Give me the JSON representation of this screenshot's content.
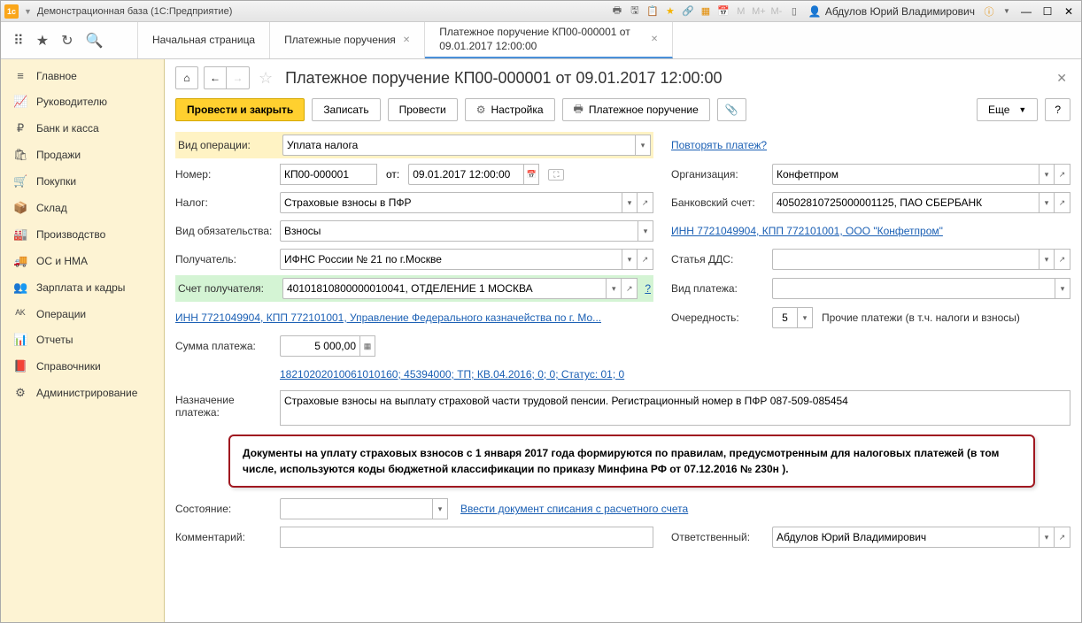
{
  "titlebar": {
    "app_title": "Демонстрационная база  (1С:Предприятие)",
    "user": "Абдулов Юрий Владимирович"
  },
  "tabs": [
    {
      "label": "Начальная страница"
    },
    {
      "label": "Платежные поручения"
    },
    {
      "label": "Платежное поручение КП00-000001 от 09.01.2017 12:00:00"
    }
  ],
  "sidebar": {
    "items": [
      {
        "icon": "≡",
        "label": "Главное"
      },
      {
        "icon": "📈",
        "label": "Руководителю"
      },
      {
        "icon": "₽",
        "label": "Банк и касса"
      },
      {
        "icon": "🛍",
        "label": "Продажи"
      },
      {
        "icon": "🛒",
        "label": "Покупки"
      },
      {
        "icon": "📦",
        "label": "Склад"
      },
      {
        "icon": "🏭",
        "label": "Производство"
      },
      {
        "icon": "🚚",
        "label": "ОС и НМА"
      },
      {
        "icon": "👥",
        "label": "Зарплата и кадры"
      },
      {
        "icon": "ᴬᴷ",
        "label": "Операции"
      },
      {
        "icon": "📊",
        "label": "Отчеты"
      },
      {
        "icon": "📕",
        "label": "Справочники"
      },
      {
        "icon": "⚙",
        "label": "Администрирование"
      }
    ]
  },
  "doc": {
    "title": "Платежное поручение КП00-000001 от 09.01.2017 12:00:00",
    "actions": {
      "post_close": "Провести и закрыть",
      "save": "Записать",
      "post": "Провести",
      "settings": "Настройка",
      "print": "Платежное поручение",
      "more": "Еще"
    },
    "op_type_label": "Вид операции:",
    "op_type": "Уплата налога",
    "repeat_link": "Повторять платеж?",
    "number_label": "Номер:",
    "number": "КП00-000001",
    "from_label": "от:",
    "date": "09.01.2017 12:00:00",
    "org_label": "Организация:",
    "org": "Конфетпром",
    "tax_label": "Налог:",
    "tax": "Страховые взносы в ПФР",
    "bank_acc_label": "Банковский счет:",
    "bank_acc": "40502810725000001125, ПАО СБЕРБАНК",
    "obl_type_label": "Вид обязательства:",
    "obl_type": "Взносы",
    "inn_kpp_link": "ИНН 7721049904, КПП 772101001, ООО \"Конфетпром\"",
    "recipient_label": "Получатель:",
    "recipient": "ИФНС России № 21 по г.Москве",
    "dds_label": "Статья ДДС:",
    "rec_acc_label": "Счет получателя:",
    "rec_acc": "40101810800000010041, ОТДЕЛЕНИЕ 1 МОСКВА",
    "pay_type_label": "Вид платежа:",
    "treasury_link": "ИНН 7721049904, КПП 772101001, Управление Федерального казначейства по г. Мо...",
    "priority_label": "Очередность:",
    "priority": "5",
    "priority_desc": "Прочие платежи (в т.ч. налоги и взносы)",
    "amount_label": "Сумма платежа:",
    "amount": "5 000,00",
    "kbk_link": "18210202010061010160; 45394000; ТП; КВ.04.2016; 0; 0; Статус: 01; 0",
    "purpose_label": "Назначение платежа:",
    "purpose": "Страховые взносы на выплату страховой части трудовой пенсии. Регистрационный номер в ПФР 087-509-085454",
    "callout": "Документы на уплату страховых взносов с 1 января 2017 года формируются по правилам, предусмотренным для налоговых платежей (в том числе, используются коды бюджетной классификации по приказу Минфина РФ от 07.12.2016 № 230н ).",
    "state_label": "Состояние:",
    "writeoff_link": "Ввести документ списания с расчетного счета",
    "comment_label": "Комментарий:",
    "responsible_label": "Ответственный:",
    "responsible": "Абдулов Юрий Владимирович"
  }
}
